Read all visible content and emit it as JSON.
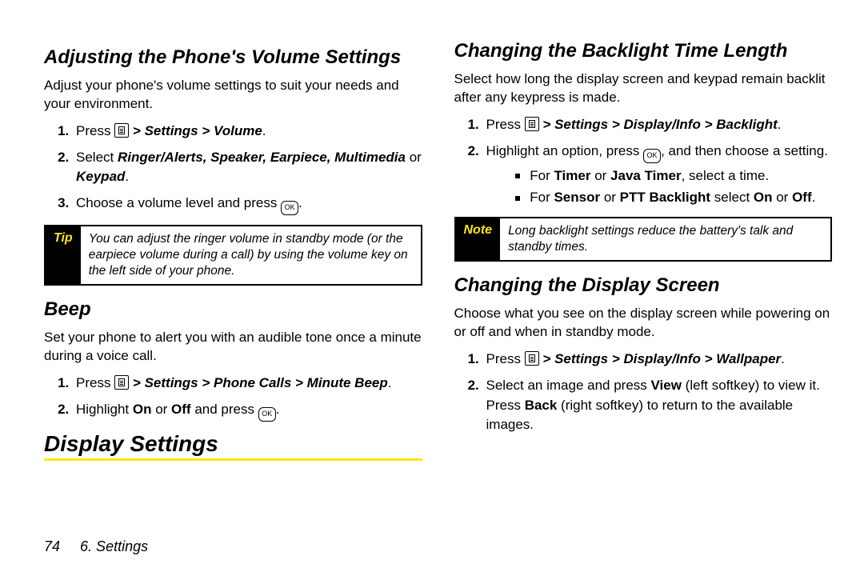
{
  "left": {
    "h2a": "Adjusting the Phone's Volume Settings",
    "p1": "Adjust your phone's volume settings to suit your needs and your environment.",
    "l1a_pre": "Press ",
    "l1a_path": "> Settings > Volume",
    "l1b_pre": "Select ",
    "l1b_bold": "Ringer/Alerts, Speaker, Earpiece, Multimedia",
    "l1b_mid": " or ",
    "l1b_bold2": "Keypad",
    "l1c_pre": "Choose a volume level and press ",
    "tip_tag": "Tip",
    "tip_body": "You can adjust the ringer volume in standby mode (or the earpiece volume during a call) by using the volume key on the left side of your phone.",
    "h2b": "Beep",
    "p2": "Set your phone to alert you with an audible tone once a minute during a voice call.",
    "l2a_pre": "Press ",
    "l2a_path": "> Settings > Phone Calls > Minute Beep",
    "l2b_pre": "Highlight ",
    "l2b_on": "On",
    "l2b_or": " or ",
    "l2b_off": "Off",
    "l2b_post": " and press "
  },
  "right": {
    "h1": "Display Settings",
    "h2a": "Changing the Backlight Time Length",
    "p1": "Select how long the display screen and keypad remain backlit after any keypress is made.",
    "l1a_pre": "Press ",
    "l1a_path": "> Settings > Display/Info > Backlight",
    "l1b_pre": "Highlight an option, press ",
    "l1b_post": ", and then choose a setting.",
    "sub1_pre": "For ",
    "sub1_b1": "Timer",
    "sub1_or": " or ",
    "sub1_b2": "Java Timer",
    "sub1_post": ", select a time.",
    "sub2_pre": "For ",
    "sub2_b1": "Sensor",
    "sub2_or": " or ",
    "sub2_b2": "PTT Backlight",
    "sub2_mid": " select ",
    "sub2_on": "On",
    "sub2_or2": " or ",
    "sub2_off": "Off",
    "note_tag": "Note",
    "note_body": "Long backlight settings reduce the battery's talk and standby times.",
    "h2b": "Changing the Display Screen",
    "p2": "Choose what you see on the display screen while powering on or off and when in standby mode.",
    "l2a_pre": "Press ",
    "l2a_path": "> Settings > Display/Info > Wallpaper",
    "l2b_pre": "Select an image and press ",
    "l2b_view": "View",
    "l2b_mid": " (left softkey) to view it. Press ",
    "l2b_back": "Back",
    "l2b_post": " (right softkey) to return to the available images."
  },
  "footer": {
    "page": "74",
    "section": "6. Settings"
  },
  "icons": {
    "ok": "OK"
  }
}
